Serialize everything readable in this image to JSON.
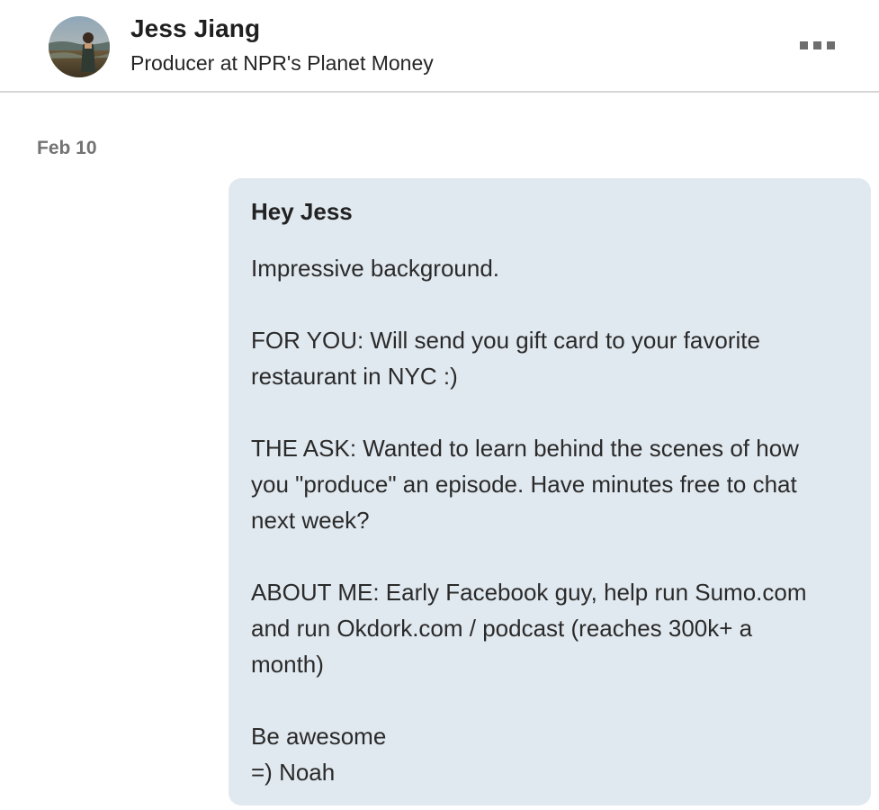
{
  "header": {
    "name": "Jess Jiang",
    "headline": "Producer at NPR's Planet Money",
    "avatar_icon": "profile-photo",
    "more_icon": "ellipsis-icon"
  },
  "conversation": {
    "date": "Feb 10",
    "message": {
      "greeting": "Hey Jess",
      "lines": [
        "Impressive background.",
        "",
        "FOR YOU: Will send you gift card to your favorite",
        "restaurant in NYC :)",
        "",
        "THE ASK: Wanted to learn behind the scenes of how",
        "you \"produce\" an episode. Have minutes free to chat",
        "next week?",
        "",
        "ABOUT ME: Early Facebook guy, help run Sumo.com",
        "and run Okdork.com / podcast (reaches 300k+ a",
        "month)",
        "",
        "Be awesome",
        "=) Noah"
      ]
    }
  },
  "colors": {
    "bubble_background": "#e1e9f0",
    "divider": "#d6d6d6",
    "date_text": "#737373"
  }
}
